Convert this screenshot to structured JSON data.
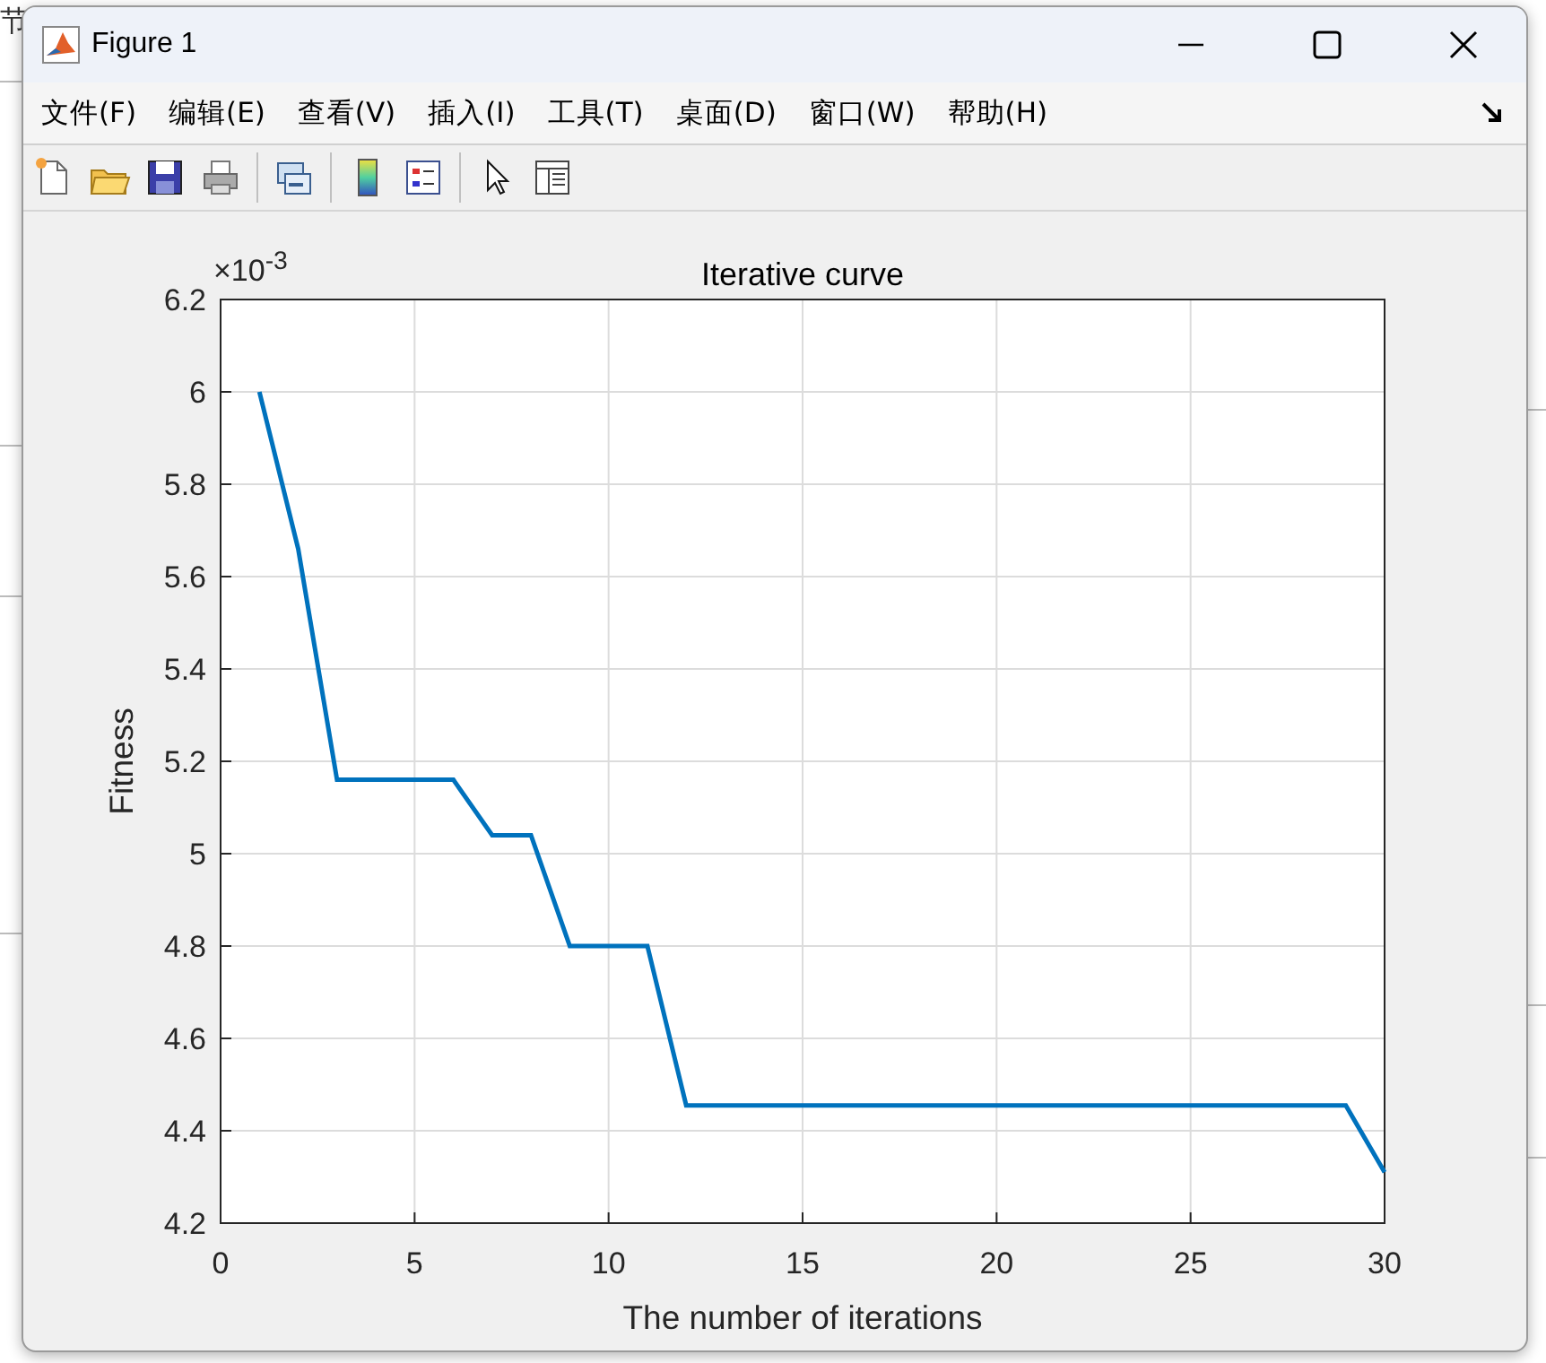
{
  "background_fragments": [
    "节"
  ],
  "window": {
    "title": "Figure 1"
  },
  "menu": [
    "文件(F)",
    "编辑(E)",
    "查看(V)",
    "插入(I)",
    "工具(T)",
    "桌面(D)",
    "窗口(W)",
    "帮助(H)"
  ],
  "toolbar": [
    {
      "kind": "new"
    },
    {
      "kind": "open"
    },
    {
      "kind": "save"
    },
    {
      "kind": "print"
    },
    {
      "kind": "link"
    },
    {
      "kind": "colorbar"
    },
    {
      "kind": "legend"
    },
    {
      "kind": "pointer"
    },
    {
      "kind": "inspector"
    }
  ],
  "chart": {
    "exponent": "×10$^{-3}$",
    "chart_data": {
      "type": "line",
      "title": "Iterative curve",
      "xlabel": "The number of iterations",
      "ylabel": "Fitness",
      "x": [
        1,
        2,
        3,
        4,
        5,
        6,
        7,
        8,
        9,
        10,
        11,
        12,
        13,
        14,
        15,
        16,
        17,
        18,
        19,
        20,
        21,
        22,
        23,
        24,
        25,
        26,
        27,
        28,
        29,
        30
      ],
      "grid": true,
      "series": [
        {
          "color": "#0072bd",
          "values": [
            6.0,
            5.66,
            5.16,
            5.16,
            5.16,
            5.16,
            5.04,
            5.04,
            4.8,
            4.8,
            4.8,
            4.455,
            4.455,
            4.455,
            4.455,
            4.455,
            4.455,
            4.455,
            4.455,
            4.455,
            4.455,
            4.455,
            4.455,
            4.455,
            4.455,
            4.455,
            4.455,
            4.455,
            4.455,
            4.31
          ]
        }
      ],
      "xlim": [
        0,
        30
      ],
      "ylim": [
        4.2,
        6.2
      ],
      "xticks": [
        0,
        5,
        10,
        15,
        20,
        25,
        30
      ],
      "yticks": [
        4.2,
        4.4,
        4.6,
        4.8,
        {
          "value": 5,
          "label": "5"
        },
        5.2,
        5.4,
        5.6,
        5.8,
        {
          "value": 6,
          "label": "6"
        },
        6.2
      ]
    }
  }
}
